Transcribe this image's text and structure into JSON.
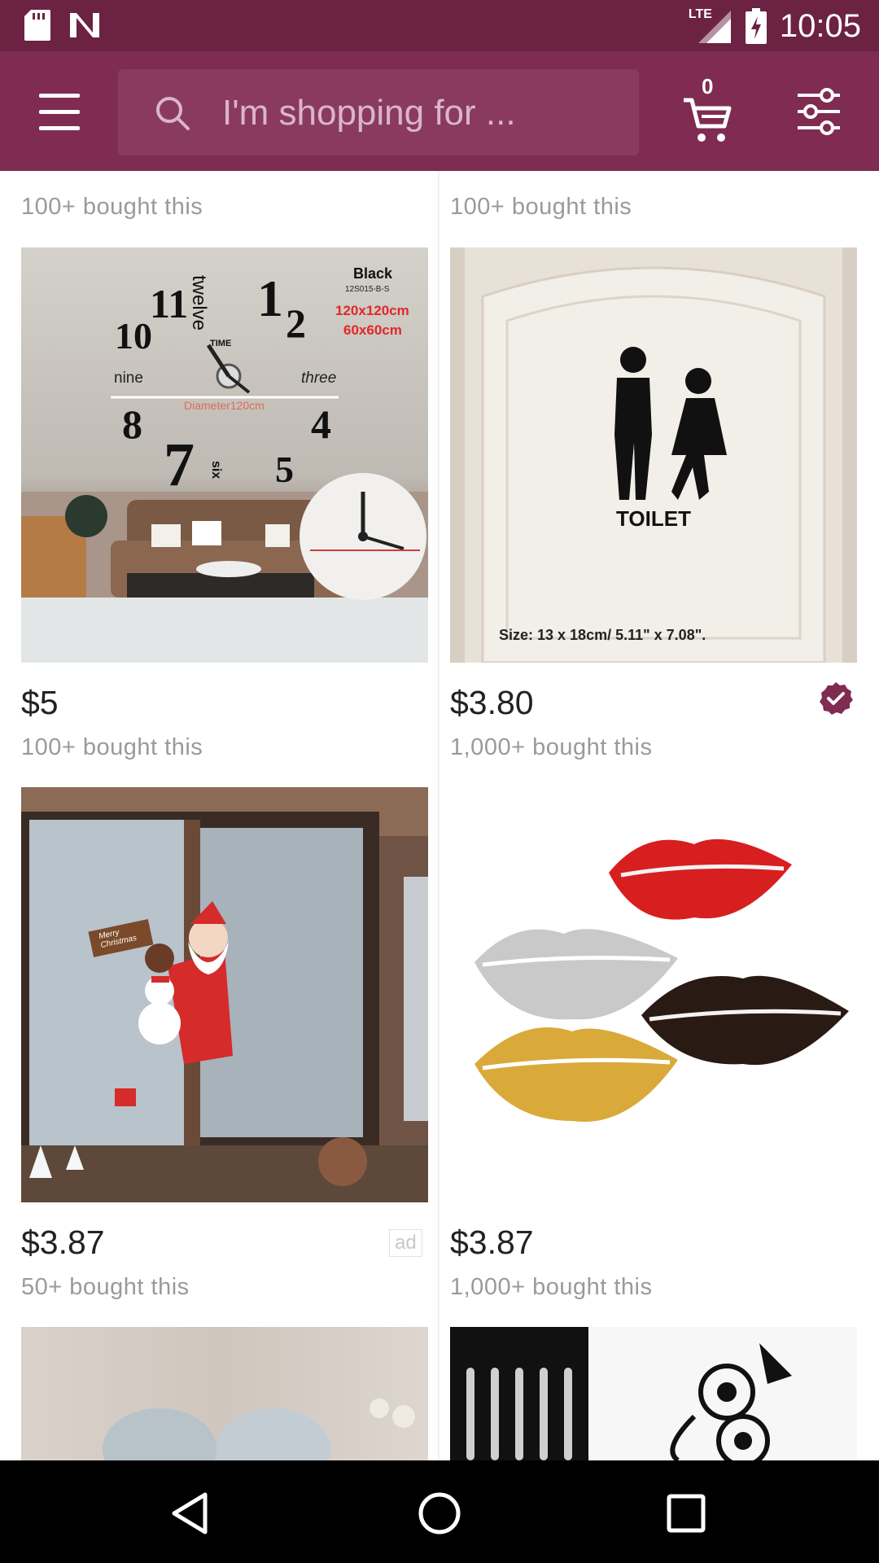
{
  "status_bar": {
    "network": "LTE",
    "time": "10:05"
  },
  "app_bar": {
    "search_placeholder": "I'm shopping for ...",
    "cart_count": "0"
  },
  "feed": {
    "top_row": [
      {
        "bought": "100+ bought this"
      },
      {
        "bought": "100+ bought this"
      }
    ],
    "products": [
      {
        "price": "$5",
        "bought": "100+ bought this",
        "image": "diy-wall-clock-image",
        "image_text": {
          "color": "Black",
          "sku": "12S015-B-S",
          "size1": "120x120cm",
          "size2": "60x60cm",
          "diameter": "Diameter120cm",
          "twelve": "twelve",
          "time": "TIME",
          "nine": "nine",
          "three": "three",
          "six": "six",
          "n11": "11",
          "n1": "1",
          "n2": "2",
          "n10": "10",
          "n8": "8",
          "n4": "4",
          "n7": "7",
          "n5": "5"
        }
      },
      {
        "price": "$3.80",
        "bought": "1,000+ bought this",
        "verified": true,
        "image": "toilet-sign-sticker-image",
        "image_text": {
          "label": "TOILET",
          "size": "Size: 13 x 18cm/ 5.11\" x 7.08\"."
        }
      },
      {
        "price": "$3.87",
        "bought": "50+ bought this",
        "ad": "ad",
        "image": "christmas-window-sticker-image",
        "image_text": {
          "sign": "Merry Christmas"
        }
      },
      {
        "price": "$3.87",
        "bought": "1,000+ bought this",
        "image": "lips-mirror-sticker-image"
      }
    ],
    "bottom_row_images": [
      "mirror-wall-image",
      "owl-decal-image"
    ]
  },
  "colors": {
    "status_bar": "#6b2243",
    "app_bar": "#7f2b52",
    "accent": "#7f2b52"
  }
}
